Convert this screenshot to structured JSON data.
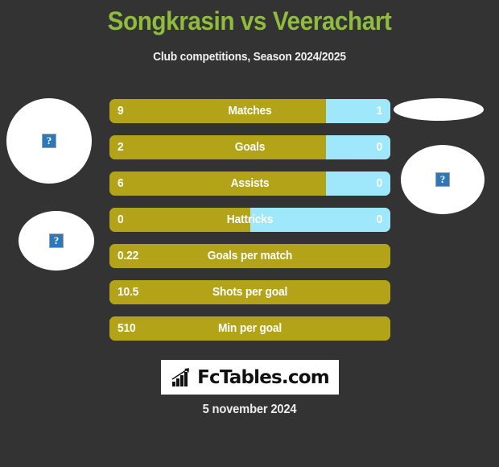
{
  "header": {
    "title": "Songkrasin vs Veerachart",
    "subtitle": "Club competitions, Season 2024/2025",
    "title_color": "#8FBB3F"
  },
  "players": {
    "left_photo_alt": "?",
    "left_photo_alt_2": "?",
    "right_photo_alt": "?"
  },
  "colors": {
    "background": "#333333",
    "home_bar": "#B3A319",
    "away_bar": "#9FE7FA",
    "label_text": "#ffffff"
  },
  "chart_data": {
    "type": "bar",
    "title": "Songkrasin vs Veerachart",
    "subtitle": "Club competitions, Season 2024/2025",
    "orientation": "horizontal-split",
    "series": [
      {
        "name": "Songkrasin",
        "color": "#B3A319"
      },
      {
        "name": "Veerachart",
        "color": "#9FE7FA"
      }
    ],
    "categories": [
      "Matches",
      "Goals",
      "Assists",
      "Hattricks",
      "Goals per match",
      "Shots per goal",
      "Min per goal"
    ],
    "rows": [
      {
        "label": "Matches",
        "left": "9",
        "right": "1",
        "left_pct": 77,
        "has_right": true
      },
      {
        "label": "Goals",
        "left": "2",
        "right": "0",
        "left_pct": 77,
        "has_right": true
      },
      {
        "label": "Assists",
        "left": "6",
        "right": "0",
        "left_pct": 77,
        "has_right": true
      },
      {
        "label": "Hattricks",
        "left": "0",
        "right": "0",
        "left_pct": 50,
        "has_right": true
      },
      {
        "label": "Goals per match",
        "left": "0.22",
        "right": "",
        "left_pct": 100,
        "has_right": false
      },
      {
        "label": "Shots per goal",
        "left": "10.5",
        "right": "",
        "left_pct": 100,
        "has_right": false
      },
      {
        "label": "Min per goal",
        "left": "510",
        "right": "",
        "left_pct": 100,
        "has_right": false
      }
    ]
  },
  "footer": {
    "logo_text": "FcTables.com",
    "date": "5 november 2024"
  }
}
